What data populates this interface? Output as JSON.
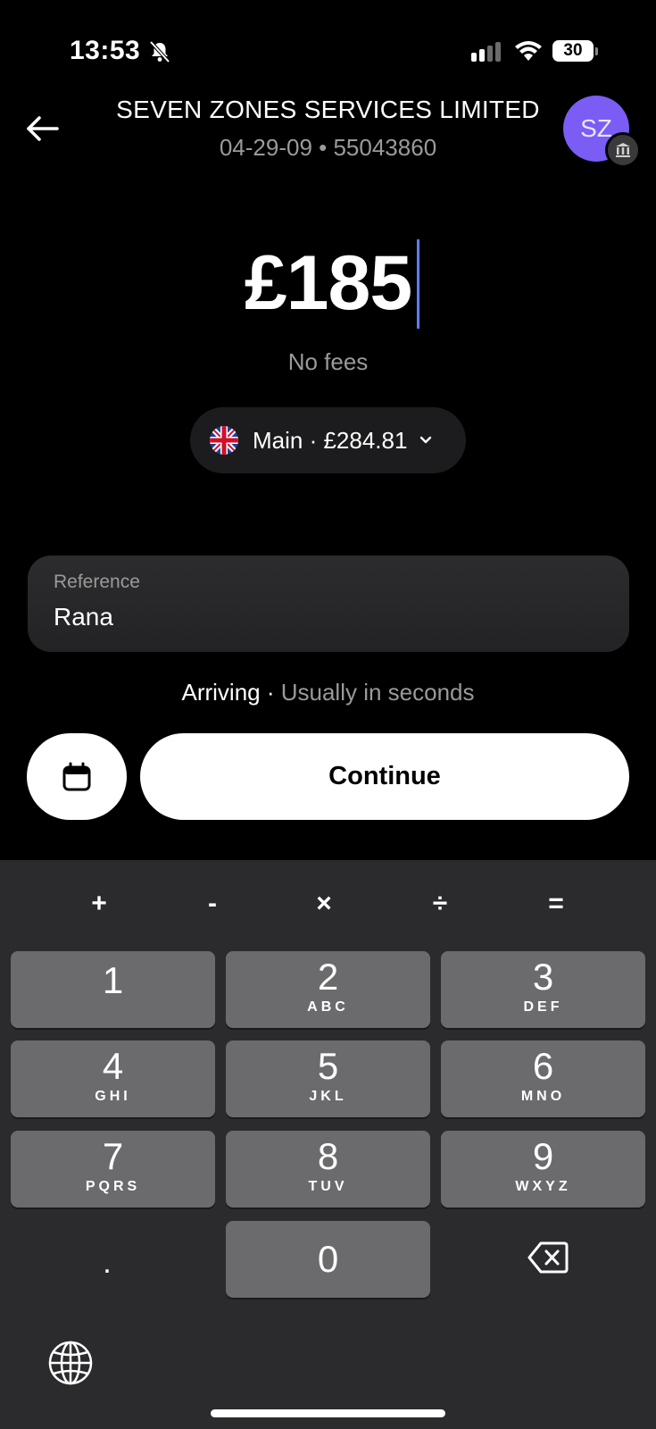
{
  "status_bar": {
    "time": "13:53",
    "battery": "30"
  },
  "header": {
    "payee_name": "SEVEN ZONES SERVICES LIMITED",
    "payee_details": "04-29-09 • 55043860",
    "avatar_initials": "SZ"
  },
  "amount": {
    "value": "£185",
    "fees": "No fees"
  },
  "account": {
    "label": "Main · £284.81"
  },
  "reference": {
    "label": "Reference",
    "value": "Rana"
  },
  "arrival": {
    "prefix": "Arriving · ",
    "eta": "Usually in seconds"
  },
  "actions": {
    "continue_label": "Continue"
  },
  "keyboard": {
    "operators": [
      "+",
      "-",
      "×",
      "÷",
      "="
    ],
    "keys": [
      {
        "num": "1",
        "letters": ""
      },
      {
        "num": "2",
        "letters": "ABC"
      },
      {
        "num": "3",
        "letters": "DEF"
      },
      {
        "num": "4",
        "letters": "GHI"
      },
      {
        "num": "5",
        "letters": "JKL"
      },
      {
        "num": "6",
        "letters": "MNO"
      },
      {
        "num": "7",
        "letters": "PQRS"
      },
      {
        "num": "8",
        "letters": "TUV"
      },
      {
        "num": "9",
        "letters": "WXYZ"
      },
      {
        "num": "0",
        "letters": ""
      }
    ],
    "decimal": "."
  }
}
